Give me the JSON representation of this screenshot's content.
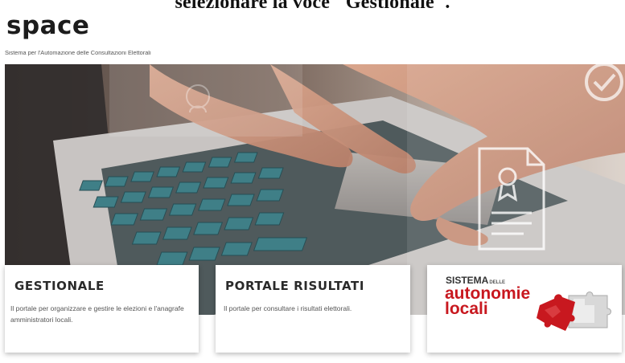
{
  "instruction": {
    "text": "selezionare la voce \"Gestionale\"."
  },
  "header": {
    "brand": "space",
    "subtitle": "Sistema per l'Automazione delle Consultazioni Elettorali"
  },
  "cards": [
    {
      "title": "GESTIONALE",
      "desc": "Il portale per organizzare e gestire le elezioni e l'anagrafe amministratori locali."
    },
    {
      "title": "PORTALE RISULTATI",
      "desc": "Il portale per consultare i risultati elettorali."
    },
    {
      "logo_top": "SISTEMA",
      "logo_small": "DELLE",
      "logo_line1": "autonomie",
      "logo_line2": "locali"
    }
  ],
  "colors": {
    "accent_red": "#c8181f",
    "keyboard_teal": "#3f7f87"
  },
  "icons": [
    "document-seal-icon",
    "checkmark-icon",
    "puzzle-icon"
  ]
}
